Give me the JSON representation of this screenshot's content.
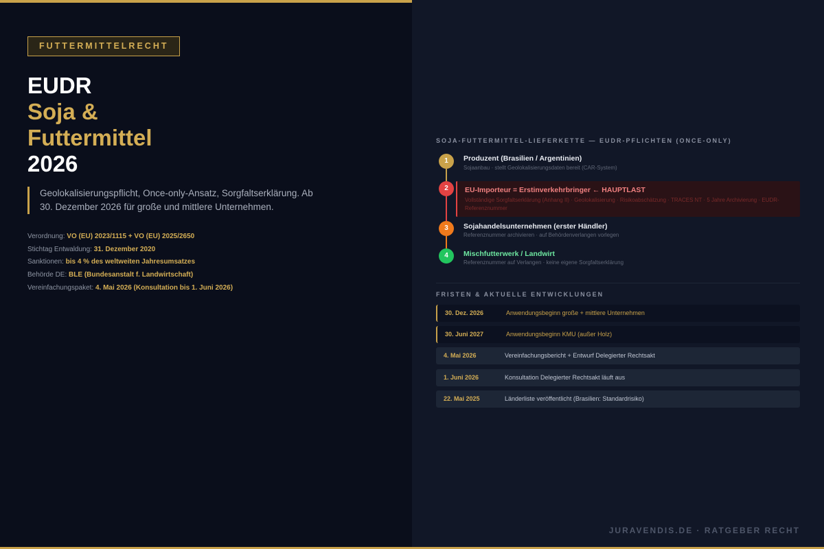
{
  "category_tag": "FUTTERMITTELRECHT",
  "title": {
    "line1": "EUDR",
    "line2": "Soja &",
    "line3": "Futtermittel",
    "line4": "2026"
  },
  "lead": "Geolokalisierungspflicht, Once-only-Ansatz, Sorgfaltserklärung. Ab 30. Dezember 2026 für große und mittlere Unternehmen.",
  "facts": [
    {
      "label": "Verordnung:",
      "value": "VO (EU) 2023/1115 + VO (EU) 2025/2650"
    },
    {
      "label": "Stichtag Entwaldung:",
      "value": "31. Dezember 2020"
    },
    {
      "label": "Sanktionen:",
      "value": "bis 4 % des weltweiten Jahresumsatzes"
    },
    {
      "label": "Behörde DE:",
      "value": "BLE (Bundesanstalt f. Landwirtschaft)"
    },
    {
      "label": "Vereinfachungspaket:",
      "value": "4. Mai 2026 (Konsultation bis 1. Juni 2026)"
    }
  ],
  "supply_chain": {
    "title": "SOJA-FUTTERMITTEL-LIEFERKETTE — EUDR-PFLICHTEN (ONCE-ONLY)",
    "steps": [
      {
        "num": "1",
        "name": "Produzent (Brasilien / Argentinien)",
        "desc": "Sojaanbau · stellt Geolokalisierungsdaten bereit (CAR-System)",
        "color": "#c9a24a"
      },
      {
        "num": "2",
        "name": "EU-Importeur = Erstinverkehrbringer ← HAUPTLAST",
        "desc": "Vollständige Sorgfaltserklärung (Anhang II) · Geolokalisierung · Risikoabschätzung · TRACES NT · 5 Jahre Archivierung · EUDR-Referenznummer",
        "color": "#e34343"
      },
      {
        "num": "3",
        "name": "Sojahandelsunternehmen (erster Händler)",
        "desc": "Referenznummer archivieren · auf Behördenverlangen vorlegen",
        "color": "#f07a1c"
      },
      {
        "num": "4",
        "name": "Mischfutterwerk / Landwirt",
        "desc": "Referenznummer auf Verlangen · keine eigene Sorgfaltserklärung",
        "color": "#22c55e"
      }
    ]
  },
  "deadlines": {
    "title": "FRISTEN & AKTUELLE ENTWICKLUNGEN",
    "items": [
      {
        "date": "30. Dez. 2026",
        "text": "Anwendungsbeginn große + mittlere Unternehmen",
        "kind": "major"
      },
      {
        "date": "30. Juni 2027",
        "text": "Anwendungsbeginn KMU (außer Holz)",
        "kind": "major"
      },
      {
        "date": "4. Mai 2026",
        "text": "Vereinfachungsbericht + Entwurf Delegierter Rechtsakt",
        "kind": "minor"
      },
      {
        "date": "1. Juni 2026",
        "text": "Konsultation Delegierter Rechtsakt läuft aus",
        "kind": "minor"
      },
      {
        "date": "22. Mai 2025",
        "text": "Länderliste veröffentlicht (Brasilien: Standardrisiko)",
        "kind": "minor"
      }
    ]
  },
  "footer": "JURAVENDIS.DE · RATGEBER RECHT",
  "colors": {
    "accent": "#c9a24a",
    "highlight": "#e34343"
  }
}
